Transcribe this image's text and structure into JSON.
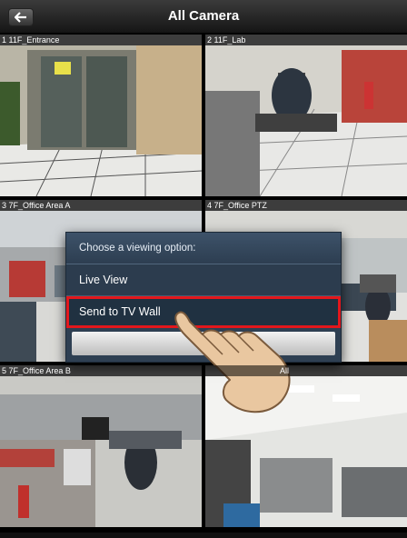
{
  "header": {
    "title": "All Camera",
    "back_icon": "back-arrow-icon"
  },
  "cameras": [
    {
      "label": "1 11F_Entrance"
    },
    {
      "label": "2 11F_Lab"
    },
    {
      "label": "3 7F_Office Area A"
    },
    {
      "label": "4 7F_Office PTZ"
    },
    {
      "label": "5 7F_Office Area B"
    },
    {
      "label": "All"
    }
  ],
  "dialog": {
    "title": "Choose a viewing option:",
    "options": [
      {
        "label": "Live View"
      },
      {
        "label": "Send to TV Wall"
      }
    ],
    "highlight_color": "#e3171c"
  }
}
